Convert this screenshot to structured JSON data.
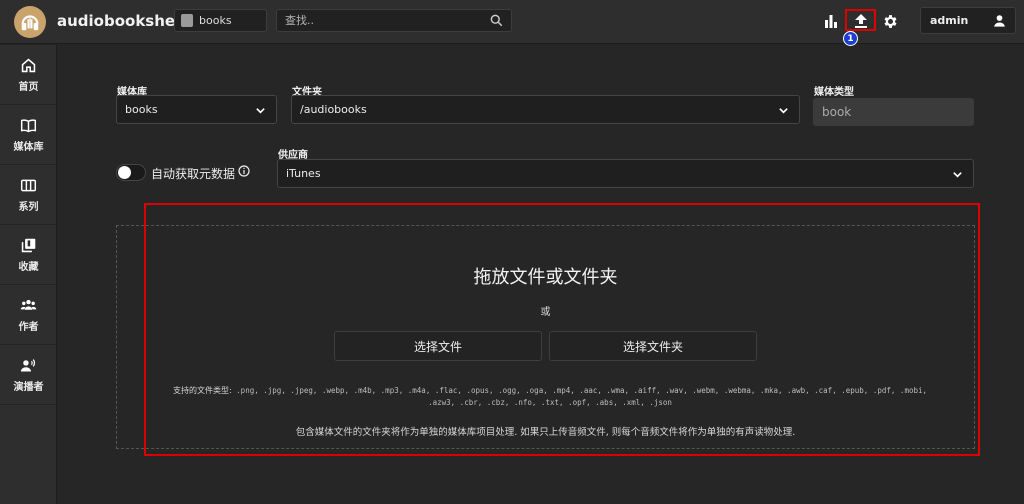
{
  "app": {
    "title": "audiobookshelf"
  },
  "header": {
    "library_select": "books",
    "search_placeholder": "查找..",
    "badge_number": "1",
    "user_label": "admin"
  },
  "sidebar": {
    "items": [
      {
        "label": "首页",
        "icon": "home-icon"
      },
      {
        "label": "媒体库",
        "icon": "book-open-icon"
      },
      {
        "label": "系列",
        "icon": "columns-icon"
      },
      {
        "label": "收藏",
        "icon": "collection-icon"
      },
      {
        "label": "作者",
        "icon": "people-icon"
      },
      {
        "label": "演播者",
        "icon": "narrator-icon"
      }
    ]
  },
  "form": {
    "library_label": "媒体库",
    "library_value": "books",
    "folder_label": "文件夹",
    "folder_value": "/audiobooks",
    "media_type_label": "媒体类型",
    "media_type_value": "book",
    "auto_fetch_label": "自动获取元数据",
    "provider_label": "供应商",
    "provider_value": "iTunes"
  },
  "dropzone": {
    "title": "拖放文件或文件夹",
    "or": "或",
    "choose_files": "选择文件",
    "choose_folder": "选择文件夹",
    "supported_label": "支持的文件类型:",
    "formats_line1": ".png, .jpg, .jpeg, .webp, .m4b, .mp3, .m4a, .flac, .opus, .ogg, .oga, .mp4, .aac, .wma, .aiff, .wav, .webm, .webma, .mka, .awb, .caf, .epub, .pdf, .mobi,",
    "formats_line2": ".azw3, .cbr, .cbz, .nfo, .txt, .opf, .abs, .xml, .json",
    "note": "包含媒体文件的文件夹将作为单独的媒体库项目处理. 如果只上传音频文件, 则每个音频文件将作为单独的有声读物处理."
  },
  "colors": {
    "highlight": "#dd0000",
    "badge": "#1d3fcf",
    "logo": "#c9a36b"
  }
}
